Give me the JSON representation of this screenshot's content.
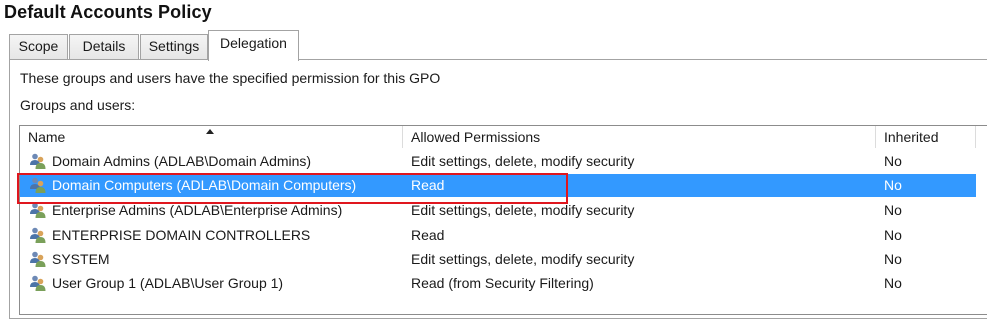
{
  "window": {
    "title": "Default Accounts Policy"
  },
  "tabs": [
    {
      "label": "Scope",
      "active": false
    },
    {
      "label": "Details",
      "active": false
    },
    {
      "label": "Settings",
      "active": false
    },
    {
      "label": "Delegation",
      "active": true
    }
  ],
  "delegation": {
    "description": "These groups and users have the specified permission for this GPO",
    "list_label": "Groups and users:",
    "columns": {
      "name": "Name",
      "permissions": "Allowed Permissions",
      "inherited": "Inherited"
    },
    "sort": {
      "column": "name",
      "direction": "ascending"
    },
    "rows": [
      {
        "icon": "user-group-icon",
        "name": "Domain Admins (ADLAB\\Domain Admins)",
        "permissions": "Edit settings, delete, modify security",
        "inherited": "No",
        "selected": false
      },
      {
        "icon": "user-group-icon",
        "name": "Domain Computers (ADLAB\\Domain Computers)",
        "permissions": "Read",
        "inherited": "No",
        "selected": true
      },
      {
        "icon": "user-group-icon",
        "name": "Enterprise Admins (ADLAB\\Enterprise Admins)",
        "permissions": "Edit settings, delete, modify security",
        "inherited": "No",
        "selected": false
      },
      {
        "icon": "user-group-icon",
        "name": "ENTERPRISE DOMAIN CONTROLLERS",
        "permissions": "Read",
        "inherited": "No",
        "selected": false
      },
      {
        "icon": "user-group-icon",
        "name": "SYSTEM",
        "permissions": "Edit settings, delete, modify security",
        "inherited": "No",
        "selected": false
      },
      {
        "icon": "user-group-icon",
        "name": "User Group 1 (ADLAB\\User Group 1)",
        "permissions": "Read (from Security Filtering)",
        "inherited": "No",
        "selected": false
      }
    ]
  },
  "colors": {
    "selection": "#3399ff",
    "highlight_box": "#e0161e",
    "border": "#a3a3a3"
  }
}
